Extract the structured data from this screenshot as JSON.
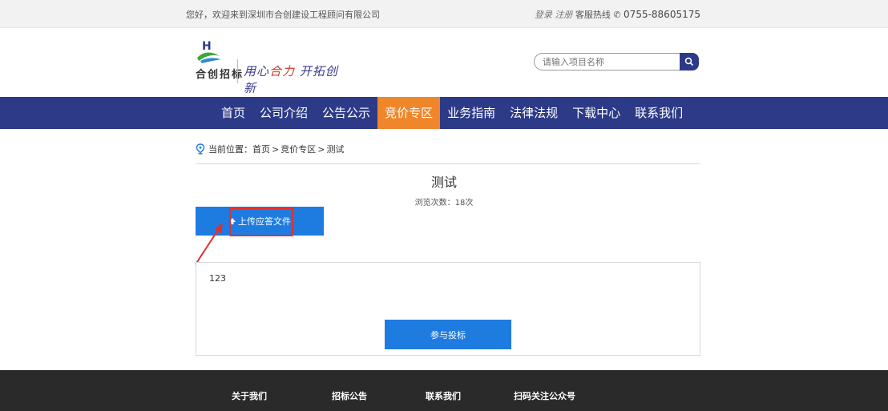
{
  "topbar": {
    "welcome": "您好，欢迎来到深圳市合创建设工程顾问有限公司",
    "login_register": "登录 注册",
    "hotline_label": "客服热线",
    "phone": "0755-88605175"
  },
  "logo": {
    "name": "合创招标",
    "slogan_part1": "用心",
    "slogan_part2": "合力",
    "slogan_part3": "开拓创新"
  },
  "search": {
    "placeholder": "请输入项目名称"
  },
  "nav": {
    "items": [
      {
        "label": "首页"
      },
      {
        "label": "公司介绍"
      },
      {
        "label": "公告公示"
      },
      {
        "label": "竞价专区",
        "active": true
      },
      {
        "label": "业务指南"
      },
      {
        "label": "法律法规"
      },
      {
        "label": "下载中心"
      },
      {
        "label": "联系我们"
      }
    ]
  },
  "breadcrumb": {
    "label": "当前位置：",
    "items": [
      "首页",
      "竞价专区",
      "测试"
    ],
    "sep": ">"
  },
  "article": {
    "title": "测试",
    "views": "浏览次数：18次",
    "upload_label": "上传应答文件",
    "content": "123",
    "join_label": "参与投标"
  },
  "footer": {
    "links": [
      "关于我们",
      "招标公告",
      "联系我们",
      "扫码关注公众号"
    ]
  },
  "colors": {
    "nav_bg": "#2d3a88",
    "nav_active": "#f0862a",
    "button_blue": "#1e7be0",
    "highlight_red": "#e03030",
    "footer_bg": "#2a2a2a"
  }
}
